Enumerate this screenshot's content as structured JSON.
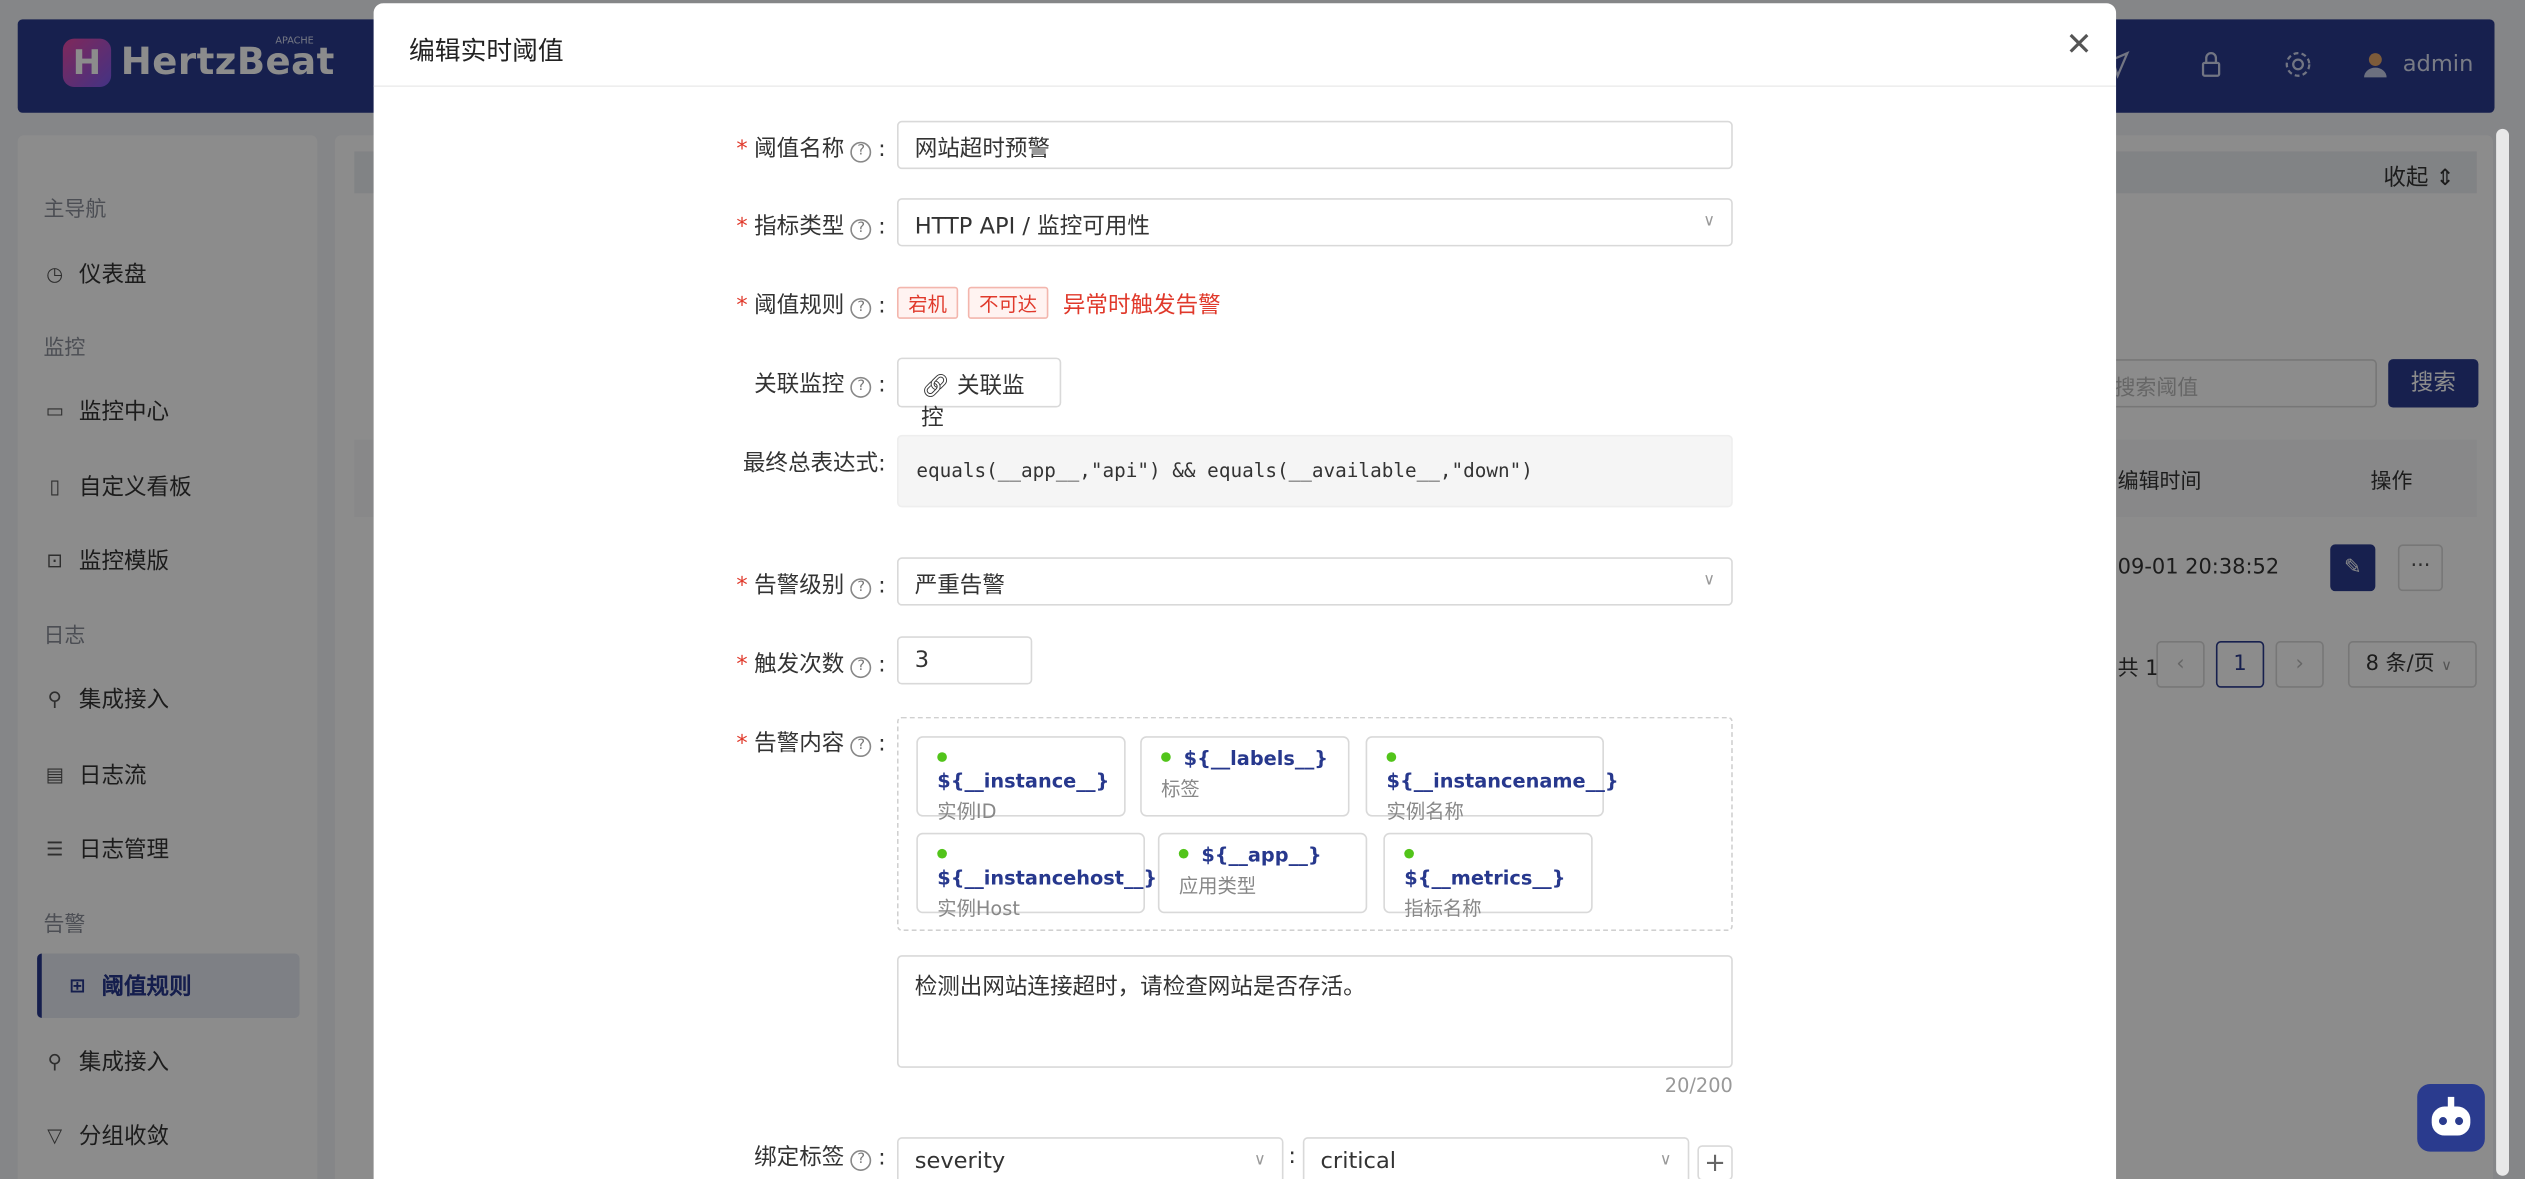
{
  "header": {
    "brand": "HertzBeat",
    "brand_sup": "APACHE",
    "user": "admin"
  },
  "sidebar": {
    "groups": [
      "主导航",
      "监控",
      "日志",
      "告警"
    ],
    "items": [
      {
        "label": "仪表盘",
        "icon": "dashboard-icon"
      },
      {
        "label": "监控中心",
        "icon": "monitor-icon"
      },
      {
        "label": "自定义看板",
        "icon": "book-icon"
      },
      {
        "label": "监控模版",
        "icon": "code-icon"
      },
      {
        "label": "集成接入",
        "icon": "plugin-icon"
      },
      {
        "label": "日志流",
        "icon": "file-icon"
      },
      {
        "label": "日志管理",
        "icon": "list-icon"
      },
      {
        "label": "阈值规则",
        "icon": "table-icon"
      },
      {
        "label": "集成接入",
        "icon": "plugin-icon"
      },
      {
        "label": "分组收敛",
        "icon": "filter-icon"
      }
    ]
  },
  "background": {
    "collapse": "收起",
    "search_placeholder": "搜索阈值",
    "search_btn": "搜索",
    "col_edit_time": "编辑时间",
    "col_ops": "操作",
    "row_time": "09-01 20:38:52",
    "pager_total": "1",
    "pager_current": "1",
    "page_size": "8 条/页"
  },
  "modal": {
    "title": "编辑实时阈值",
    "name_label": "阈值名称",
    "name_value": "网站超时预警",
    "type_label": "指标类型",
    "type_value": "HTTP API / 监控可用性",
    "rule_label": "阈值规则",
    "rule_tags": [
      "宕机",
      "不可达"
    ],
    "rule_warn": "异常时触发告警",
    "link_label": "关联监控",
    "link_btn": "关联监控",
    "expr_label": "最终总表达式",
    "expr_value": "equals(__app__,\"api\") && equals(__available__,\"down\")",
    "level_label": "告警级别",
    "level_value": "严重告警",
    "times_label": "触发次数",
    "times_value": "3",
    "content_label": "告警内容",
    "vars": [
      {
        "key": "${__instance__}",
        "desc": "实例ID"
      },
      {
        "key": "${__labels__}",
        "desc": "标签"
      },
      {
        "key": "${__instancename__}",
        "desc": "实例名称"
      },
      {
        "key": "${__instancehost__}",
        "desc": "实例Host"
      },
      {
        "key": "${__app__}",
        "desc": "应用类型"
      },
      {
        "key": "${__metrics__}",
        "desc": "指标名称"
      }
    ],
    "content_value": "检测出网站连接超时，请检查网站是否存活。",
    "content_count": "20/200",
    "label_label": "绑定标签",
    "label_key": "severity",
    "label_value": "critical"
  }
}
